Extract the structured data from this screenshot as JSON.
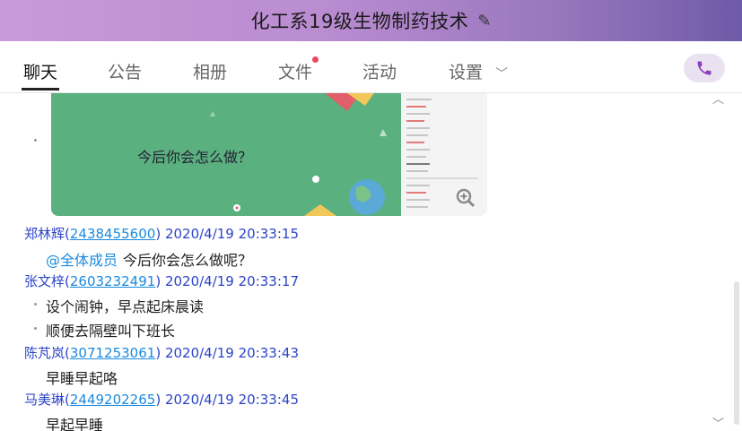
{
  "window": {
    "title": "化工系19级生物制药技术",
    "edit_icon": "pencil-icon"
  },
  "tabs": [
    {
      "label": "聊天",
      "active": true
    },
    {
      "label": "公告"
    },
    {
      "label": "相册"
    },
    {
      "label": "文件",
      "badge": true
    },
    {
      "label": "活动"
    },
    {
      "label": "设置",
      "dropdown": true
    }
  ],
  "call_button_icon": "phone-icon",
  "colors": {
    "accent": "#8e3fbf",
    "link": "#1a8ae0",
    "sender": "#2b43c9",
    "image_green": "#5bb07f"
  },
  "image_message": {
    "caption": "今后你会怎么做？",
    "zoom_icon": "zoom-in-icon"
  },
  "messages": [
    {
      "sender": "郑林辉",
      "qq": "2438455600",
      "time": "2020/4/19 20:33:15",
      "lines": [
        {
          "mention": "@全体成员",
          "text": "今后你会怎么做呢？"
        }
      ]
    },
    {
      "sender": "张文梓",
      "qq": "2603232491",
      "time": "2020/4/19 20:33:17",
      "lines": [
        {
          "text": "设个闹钟，早点起床晨读"
        },
        {
          "text": "顺便去隔壁叫下班长"
        }
      ]
    },
    {
      "sender": "陈芃岚",
      "qq": "3071253061",
      "time": "2020/4/19 20:33:43",
      "lines": [
        {
          "text": "早睡早起咯"
        }
      ]
    },
    {
      "sender": "马美琳",
      "qq": "2449202265",
      "time": "2020/4/19 20:33:45",
      "lines": [
        {
          "text": "早起早睡"
        }
      ]
    }
  ]
}
